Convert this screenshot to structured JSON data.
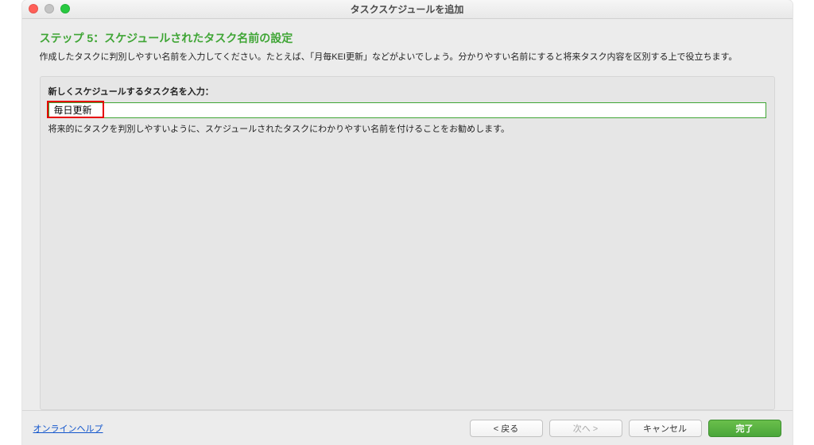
{
  "window": {
    "title": "タスクスケジュールを追加"
  },
  "step": {
    "title": "ステップ 5：スケジュールされたタスク名前の設定",
    "description": "作成したタスクに判別しやすい名前を入力してください。たとえば、「月毎KEI更新」などがよいでしょう。分かりやすい名前にすると将来タスク内容を区別する上で役立ちます。"
  },
  "form": {
    "label": "新しくスケジュールするタスク名を入力：",
    "task_name_value": "毎日更新",
    "hint": "将来的にタスクを判別しやすいように、スケジュールされたタスクにわかりやすい名前を付けることをお勧めします。"
  },
  "footer": {
    "help_link": "オンラインヘルプ",
    "back": "< 戻る",
    "next": "次へ >",
    "cancel": "キャンセル",
    "finish": "完了"
  },
  "colors": {
    "accent_green": "#3fa535",
    "highlight_red": "#e60000",
    "link_blue": "#1155cc"
  }
}
